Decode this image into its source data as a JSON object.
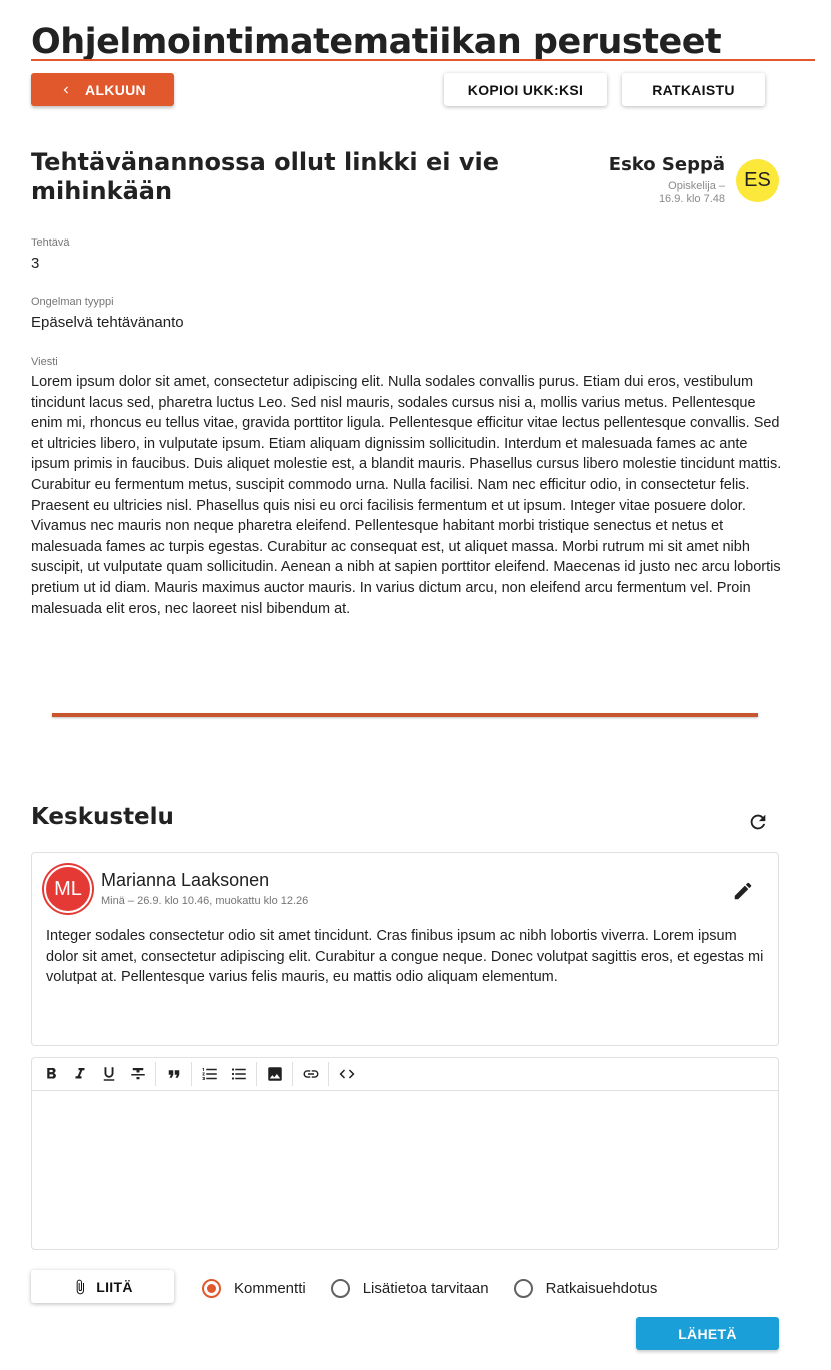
{
  "course": {
    "title": "Ohjelmointimatematiikan perusteet"
  },
  "actions": {
    "back_label": "ALKUUN",
    "copy_faq_label": "KOPIOI UKK:KSI",
    "resolved_label": "RATKAISTU"
  },
  "question": {
    "title": "Tehtävänannossa ollut linkki ei vie mihinkään",
    "author_name": "Esko Seppä",
    "author_role": "Opiskelija –",
    "author_time": "16.9. klo 7.48",
    "author_initials": "ES",
    "task_label": "Tehtävä",
    "task_value": "3",
    "type_label": "Ongelman tyyppi",
    "type_value": "Epäselvä tehtävänanto",
    "message_label": "Viesti",
    "message": "Lorem ipsum dolor sit amet, consectetur adipiscing elit. Nulla sodales convallis purus. Etiam dui eros, vestibulum tincidunt lacus sed, pharetra luctus Leo. Sed nisl mauris, sodales cursus nisi a, mollis varius metus. Pellentesque enim mi, rhoncus eu tellus vitae, gravida porttitor ligula. Pellentesque efficitur vitae lectus pellentesque convallis. Sed et ultricies libero, in vulputate ipsum. Etiam aliquam dignissim sollicitudin. Interdum et malesuada fames ac ante ipsum primis in faucibus. Duis aliquet molestie est, a blandit mauris. Phasellus cursus libero molestie tincidunt mattis. Curabitur eu fermentum metus, suscipit commodo urna. Nulla facilisi. Nam nec efficitur odio, in consectetur felis. Praesent eu ultricies nisl. Phasellus quis nisi eu orci facilisis fermentum et ut ipsum. Integer vitae posuere dolor. Vivamus nec mauris non neque pharetra eleifend. Pellentesque habitant morbi tristique senectus et netus et malesuada fames ac turpis egestas. Curabitur ac consequat est, ut aliquet massa. Morbi rutrum mi sit amet nibh suscipit, ut vulputate quam sollicitudin. Aenean a nibh at sapien porttitor eleifend. Maecenas id justo nec arcu lobortis pretium ut id diam. Mauris maximus auctor mauris. In varius dictum arcu, non eleifend arcu fermentum vel. Proin malesuada elit eros, nec laoreet nisl bibendum at."
  },
  "discussion": {
    "title": "Keskustelu",
    "comments": [
      {
        "initials": "ML",
        "author": "Marianna Laaksonen",
        "meta": "Minä – 26.9. klo 10.46, muokattu klo 12.26",
        "text": "Integer sodales consectetur odio sit amet tincidunt. Cras finibus ipsum ac nibh lobortis viverra. Lorem ipsum dolor sit amet, consectetur adipiscing elit. Curabitur a congue neque. Donec volutpat sagittis eros, et egestas mi volutpat at. Pellentesque varius felis mauris, eu mattis odio aliquam elementum."
      }
    ]
  },
  "editor": {
    "toolbar": [
      "bold-icon",
      "italic-icon",
      "underline-icon",
      "strikethrough-icon",
      "quote-icon",
      "numbered-list-icon",
      "bulleted-list-icon",
      "image-icon",
      "link-icon",
      "code-icon"
    ],
    "value": ""
  },
  "reply": {
    "attach_label": "LIITÄ",
    "options": [
      {
        "label": "Kommentti",
        "checked": true
      },
      {
        "label": "Lisätietoa tarvitaan",
        "checked": false
      },
      {
        "label": "Ratkaisuehdotus",
        "checked": false
      }
    ],
    "send_label": "LÄHETÄ"
  },
  "colors": {
    "accent": "#e0582b",
    "send": "#1a9fd8",
    "avatar_es": "#fce83a",
    "avatar_ml": "#e53935"
  }
}
